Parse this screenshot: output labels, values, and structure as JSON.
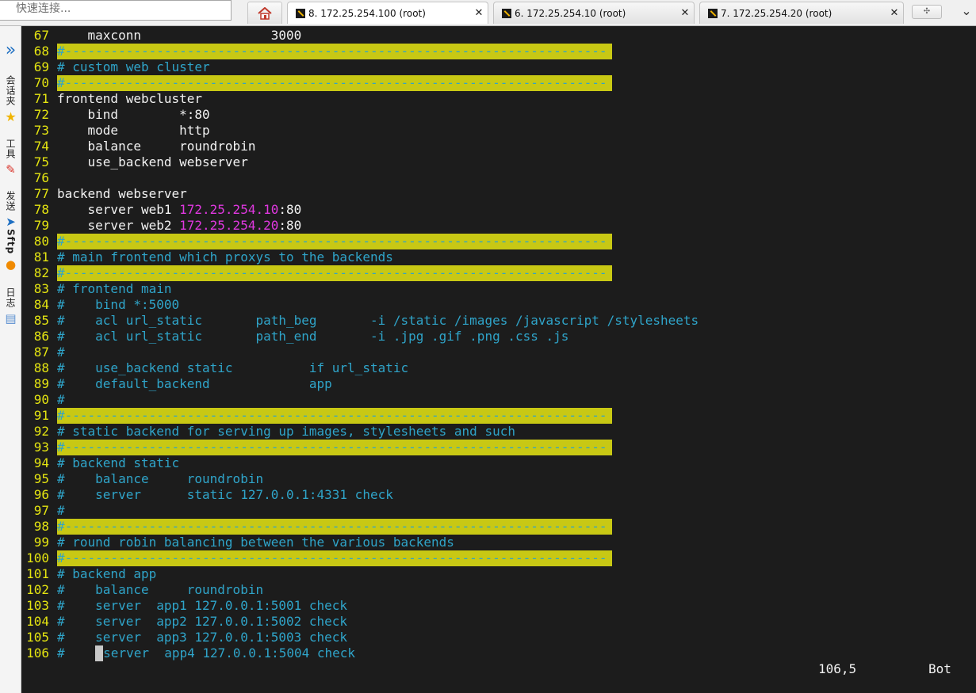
{
  "quick_connect": {
    "placeholder": "快速连接..."
  },
  "tabs": [
    {
      "label": "8. 172.25.254.100 (root)",
      "active": true
    },
    {
      "label": "6. 172.25.254.10 (root)",
      "active": false
    },
    {
      "label": "7. 172.25.254.20 (root)",
      "active": false
    }
  ],
  "new_tab_label": "✣",
  "window_control": "⌄",
  "sidebar": {
    "expand_glyph": "»",
    "sessions": "会话夹",
    "tools": "工具",
    "send": "发送",
    "sftp": "Sftp",
    "log": "日志"
  },
  "colors": {
    "terminal_bg": "#1c1c1c",
    "line_number": "#e4e411",
    "comment": "#2fa4c9",
    "ip_highlight": "#e038e0",
    "separator_bg": "#c8c814"
  },
  "lines": [
    {
      "n": "67",
      "segs": [
        {
          "t": "    maxconn                 3000",
          "c": ""
        }
      ]
    },
    {
      "n": "68",
      "segs": [
        {
          "t": "#-----------------------------------------------------------------------",
          "c": "sep"
        }
      ]
    },
    {
      "n": "69",
      "segs": [
        {
          "t": "# custom web cluster",
          "c": "cmt"
        }
      ]
    },
    {
      "n": "70",
      "segs": [
        {
          "t": "#-----------------------------------------------------------------------",
          "c": "sep"
        }
      ]
    },
    {
      "n": "71",
      "segs": [
        {
          "t": "frontend webcluster",
          "c": ""
        }
      ]
    },
    {
      "n": "72",
      "segs": [
        {
          "t": "    bind        *:80",
          "c": ""
        }
      ]
    },
    {
      "n": "73",
      "segs": [
        {
          "t": "    mode        http",
          "c": ""
        }
      ]
    },
    {
      "n": "74",
      "segs": [
        {
          "t": "    balance     roundrobin",
          "c": ""
        }
      ]
    },
    {
      "n": "75",
      "segs": [
        {
          "t": "    use_backend webserver",
          "c": ""
        }
      ]
    },
    {
      "n": "76",
      "segs": [
        {
          "t": "",
          "c": ""
        }
      ]
    },
    {
      "n": "77",
      "segs": [
        {
          "t": "backend webserver",
          "c": ""
        }
      ]
    },
    {
      "n": "78",
      "segs": [
        {
          "t": "    server web1 ",
          "c": ""
        },
        {
          "t": "172.25.254.10",
          "c": "ip"
        },
        {
          "t": ":80",
          "c": ""
        }
      ]
    },
    {
      "n": "79",
      "segs": [
        {
          "t": "    server web2 ",
          "c": ""
        },
        {
          "t": "172.25.254.20",
          "c": "ip"
        },
        {
          "t": ":80",
          "c": ""
        }
      ]
    },
    {
      "n": "80",
      "segs": [
        {
          "t": "#-----------------------------------------------------------------------",
          "c": "sep"
        }
      ]
    },
    {
      "n": "81",
      "segs": [
        {
          "t": "# main frontend which proxys to the backends",
          "c": "cmt"
        }
      ]
    },
    {
      "n": "82",
      "segs": [
        {
          "t": "#-----------------------------------------------------------------------",
          "c": "sep"
        }
      ]
    },
    {
      "n": "83",
      "segs": [
        {
          "t": "# frontend main",
          "c": "cmt"
        }
      ]
    },
    {
      "n": "84",
      "segs": [
        {
          "t": "#    bind *:5000",
          "c": "cmt"
        }
      ]
    },
    {
      "n": "85",
      "segs": [
        {
          "t": "#    acl url_static       path_beg       -i /static /images /javascript /stylesheets",
          "c": "cmt"
        }
      ]
    },
    {
      "n": "86",
      "segs": [
        {
          "t": "#    acl url_static       path_end       -i .jpg .gif .png .css .js",
          "c": "cmt"
        }
      ]
    },
    {
      "n": "87",
      "segs": [
        {
          "t": "#",
          "c": "cmt"
        }
      ]
    },
    {
      "n": "88",
      "segs": [
        {
          "t": "#    use_backend static          if url_static",
          "c": "cmt"
        }
      ]
    },
    {
      "n": "89",
      "segs": [
        {
          "t": "#    default_backend             app",
          "c": "cmt"
        }
      ]
    },
    {
      "n": "90",
      "segs": [
        {
          "t": "#",
          "c": "cmt"
        }
      ]
    },
    {
      "n": "91",
      "segs": [
        {
          "t": "#-----------------------------------------------------------------------",
          "c": "sep"
        }
      ]
    },
    {
      "n": "92",
      "segs": [
        {
          "t": "# static backend for serving up images, stylesheets and such",
          "c": "cmt"
        }
      ]
    },
    {
      "n": "93",
      "segs": [
        {
          "t": "#-----------------------------------------------------------------------",
          "c": "sep"
        }
      ]
    },
    {
      "n": "94",
      "segs": [
        {
          "t": "# backend static",
          "c": "cmt"
        }
      ]
    },
    {
      "n": "95",
      "segs": [
        {
          "t": "#    balance     roundrobin",
          "c": "cmt"
        }
      ]
    },
    {
      "n": "96",
      "segs": [
        {
          "t": "#    server      static 127.0.0.1:4331 check",
          "c": "cmt"
        }
      ]
    },
    {
      "n": "97",
      "segs": [
        {
          "t": "#",
          "c": "cmt"
        }
      ]
    },
    {
      "n": "98",
      "segs": [
        {
          "t": "#-----------------------------------------------------------------------",
          "c": "sep"
        }
      ]
    },
    {
      "n": "99",
      "segs": [
        {
          "t": "# round robin balancing between the various backends",
          "c": "cmt"
        }
      ]
    },
    {
      "n": "100",
      "segs": [
        {
          "t": "#-----------------------------------------------------------------------",
          "c": "sep"
        }
      ]
    },
    {
      "n": "101",
      "segs": [
        {
          "t": "# backend app",
          "c": "cmt"
        }
      ]
    },
    {
      "n": "102",
      "segs": [
        {
          "t": "#    balance     roundrobin",
          "c": "cmt"
        }
      ]
    },
    {
      "n": "103",
      "segs": [
        {
          "t": "#    server  app1 127.0.0.1:5001 check",
          "c": "cmt"
        }
      ]
    },
    {
      "n": "104",
      "segs": [
        {
          "t": "#    server  app2 127.0.0.1:5002 check",
          "c": "cmt"
        }
      ]
    },
    {
      "n": "105",
      "segs": [
        {
          "t": "#    server  app3 127.0.0.1:5003 check",
          "c": "cmt"
        }
      ]
    },
    {
      "n": "106",
      "segs": [
        {
          "t": "#    ",
          "c": "cmt"
        },
        {
          "t": " ",
          "c": "cursor"
        },
        {
          "t": "server  app4 127.0.0.1:5004 check",
          "c": "cmt"
        }
      ]
    }
  ],
  "status": {
    "position": "106,5",
    "scroll": "Bot"
  }
}
